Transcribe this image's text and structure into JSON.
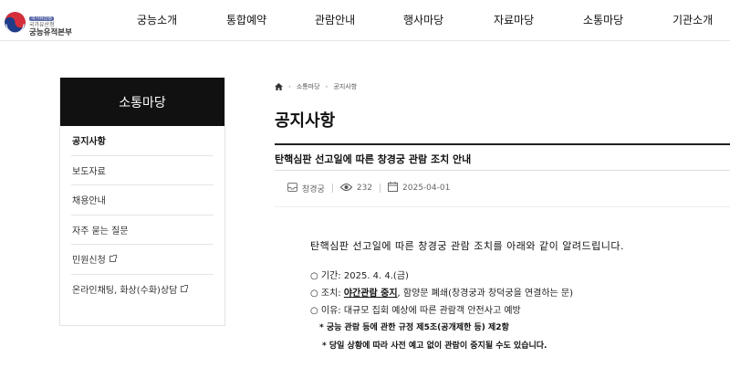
{
  "header": {
    "logo": {
      "line1": "국가유산청",
      "line2": "국가유산청",
      "line3": "궁능유적본부"
    },
    "nav": [
      "궁능소개",
      "통합예약",
      "관람안내",
      "행사마당",
      "자료마당",
      "소통마당",
      "기관소개"
    ]
  },
  "sidebar": {
    "title": "소통마당",
    "items": [
      {
        "label": "공지사항"
      },
      {
        "label": "보도자료"
      },
      {
        "label": "채용안내"
      },
      {
        "label": "자주 묻는 질문"
      },
      {
        "label": "민원신청"
      },
      {
        "label": "온라인채팅, 화상(수화)상담"
      }
    ]
  },
  "breadcrumb": {
    "items": [
      "소통마당",
      "공지사항"
    ]
  },
  "page": {
    "title": "공지사항"
  },
  "post": {
    "title": "탄핵심판 선고일에 따른 창경궁 관람 조치 안내",
    "author": "창경궁",
    "views": "232",
    "date": "2025-04-01",
    "lead": "탄핵심판 선고일에 따른 창경궁 관람 조치를 아래와 같이 알려드립니다.",
    "period_label": "○ 기간: 2025. 4. 4.(금)",
    "measure_prefix": "○ 조치: ",
    "measure_emph": "야간관람 중지",
    "measure_suffix": ", 함양문 폐쇄(창경궁과 창덕궁을 연결하는 문)",
    "reason": "○ 이유: 대규모 집회 예상에 따른 관람객 안전사고 예방",
    "note1": "* 궁능 관람 등에 관한 규정 제5조(공개제한 등) 제2항",
    "note2": "* 당일 상황에 따라 사전 예고 없이 관람이 중지될 수도 있습니다."
  },
  "colors": {
    "sidebar_head_bg": "#111111",
    "accent_text": "#111111",
    "border": "#e5e5e5"
  },
  "icons": {
    "home": "home-icon",
    "author": "inbox-icon",
    "views": "eye-icon",
    "date": "calendar-icon",
    "external": "external-link-icon"
  }
}
